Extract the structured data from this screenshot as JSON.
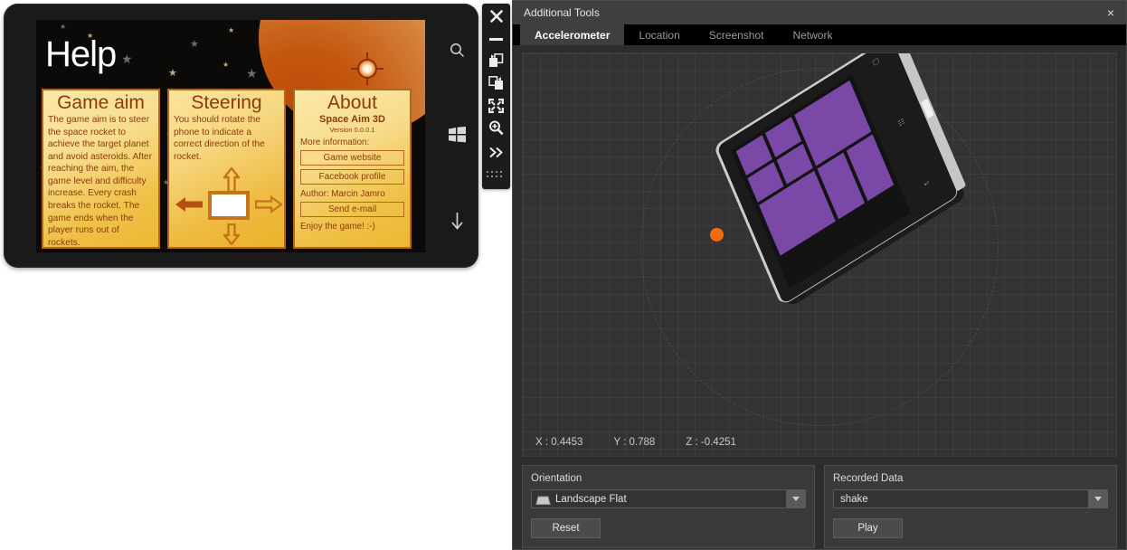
{
  "phone_app": {
    "page_title": "Help",
    "cards": [
      {
        "title": "Game aim",
        "body": "The game aim is to steer the space rocket to achieve the target planet and avoid asteroids. After reaching the aim, the game level and difficulty increase. Every crash breaks the rocket. The game ends when the player runs out of rockets."
      },
      {
        "title": "Steering",
        "body": "You should rotate the phone to indicate a correct direction of the rocket."
      },
      {
        "title": "About",
        "app_name": "Space Aim 3D",
        "version": "Version 0.0.0.1",
        "more_info_label": "More information:",
        "website_button": "Game website",
        "facebook_button": "Facebook profile",
        "author": "Author: Marcin Jamro",
        "email_button": "Send e-mail",
        "footer": "Enjoy the game! :-)"
      }
    ],
    "hardware_keys": [
      {
        "name": "search-key",
        "glyph": "search"
      },
      {
        "name": "start-key",
        "glyph": "windows"
      },
      {
        "name": "back-key",
        "glyph": "down-arrow"
      }
    ]
  },
  "emulator_toolbar": {
    "buttons": [
      {
        "name": "close-button",
        "label": "Close"
      },
      {
        "name": "minimize-button",
        "label": "Minimize"
      },
      {
        "name": "rotate-left-button",
        "label": "Rotate left"
      },
      {
        "name": "rotate-right-button",
        "label": "Rotate right"
      },
      {
        "name": "fit-to-screen-button",
        "label": "Fit to Screen"
      },
      {
        "name": "zoom-button",
        "label": "Zoom"
      },
      {
        "name": "expand-button",
        "label": "Expand"
      },
      {
        "name": "drag-handle",
        "label": "Drag"
      }
    ]
  },
  "tools_window": {
    "title": "Additional Tools",
    "close_label": "×",
    "tabs": [
      {
        "label": "Accelerometer",
        "active": true
      },
      {
        "label": "Location",
        "active": false
      },
      {
        "label": "Screenshot",
        "active": false
      },
      {
        "label": "Network",
        "active": false
      }
    ],
    "accelerometer": {
      "readout": {
        "x": "X : 0.4453",
        "y": "Y : 0.788",
        "z": "Z : -0.4251"
      },
      "orientation": {
        "label": "Orientation",
        "value": "Landscape Flat",
        "reset_button": "Reset"
      },
      "recorded_data": {
        "label": "Recorded Data",
        "value": "shake",
        "play_button": "Play"
      }
    }
  },
  "colors": {
    "accent_orange": "#f26c0d",
    "tile_purple": "#7a49a8",
    "card_gold": "#f0c24a",
    "card_text": "#8a3a0b",
    "panel_bg": "#2d2d30",
    "view_bg": "#333336"
  }
}
